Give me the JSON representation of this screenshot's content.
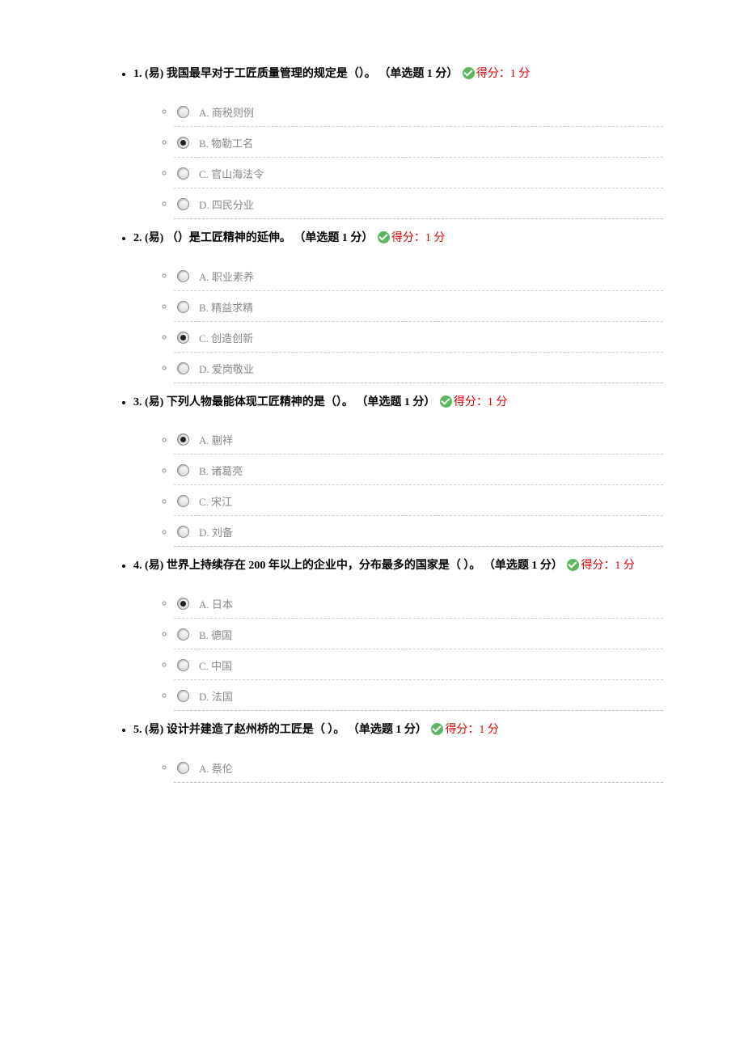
{
  "score_label": "得分：1 分",
  "questions": [
    {
      "num": "1.",
      "diff": "(易)",
      "text": "我国最早对于工匠质量管理的规定是（）。",
      "type_label": "（单选题 1 分）",
      "selected": 1,
      "options": [
        {
          "letter": "A.",
          "text": "商税则例"
        },
        {
          "letter": "B.",
          "text": "物勒工名"
        },
        {
          "letter": "C.",
          "text": "官山海法令"
        },
        {
          "letter": "D.",
          "text": "四民分业"
        }
      ]
    },
    {
      "num": "2.",
      "diff": "(易)",
      "text": "（）是工匠精神的延伸。",
      "type_label": "（单选题 1 分）",
      "selected": 2,
      "options": [
        {
          "letter": "A.",
          "text": "职业素养"
        },
        {
          "letter": "B.",
          "text": "精益求精"
        },
        {
          "letter": "C.",
          "text": "创造创新"
        },
        {
          "letter": "D.",
          "text": "爱岗敬业"
        }
      ]
    },
    {
      "num": "3.",
      "diff": "(易)",
      "text": "下列人物最能体现工匠精神的是（）。",
      "type_label": "（单选题 1 分）",
      "selected": 0,
      "options": [
        {
          "letter": "A.",
          "text": "蒯祥"
        },
        {
          "letter": "B.",
          "text": "诸葛亮"
        },
        {
          "letter": "C.",
          "text": "宋江"
        },
        {
          "letter": "D.",
          "text": "刘备"
        }
      ]
    },
    {
      "num": "4.",
      "diff": "(易)",
      "text": "世界上持续存在 200 年以上的企业中，分布最多的国家是（  ）。",
      "type_label": "（单选题 1 分）",
      "selected": 0,
      "options": [
        {
          "letter": "A.",
          "text": "日本"
        },
        {
          "letter": "B.",
          "text": "德国"
        },
        {
          "letter": "C.",
          "text": "中国"
        },
        {
          "letter": "D.",
          "text": "法国"
        }
      ]
    },
    {
      "num": "5.",
      "diff": "(易)",
      "text": "设计并建造了赵州桥的工匠是（  ）。",
      "type_label": "（单选题 1 分）",
      "selected": -1,
      "options": [
        {
          "letter": "A.",
          "text": "蔡伦"
        }
      ]
    }
  ]
}
